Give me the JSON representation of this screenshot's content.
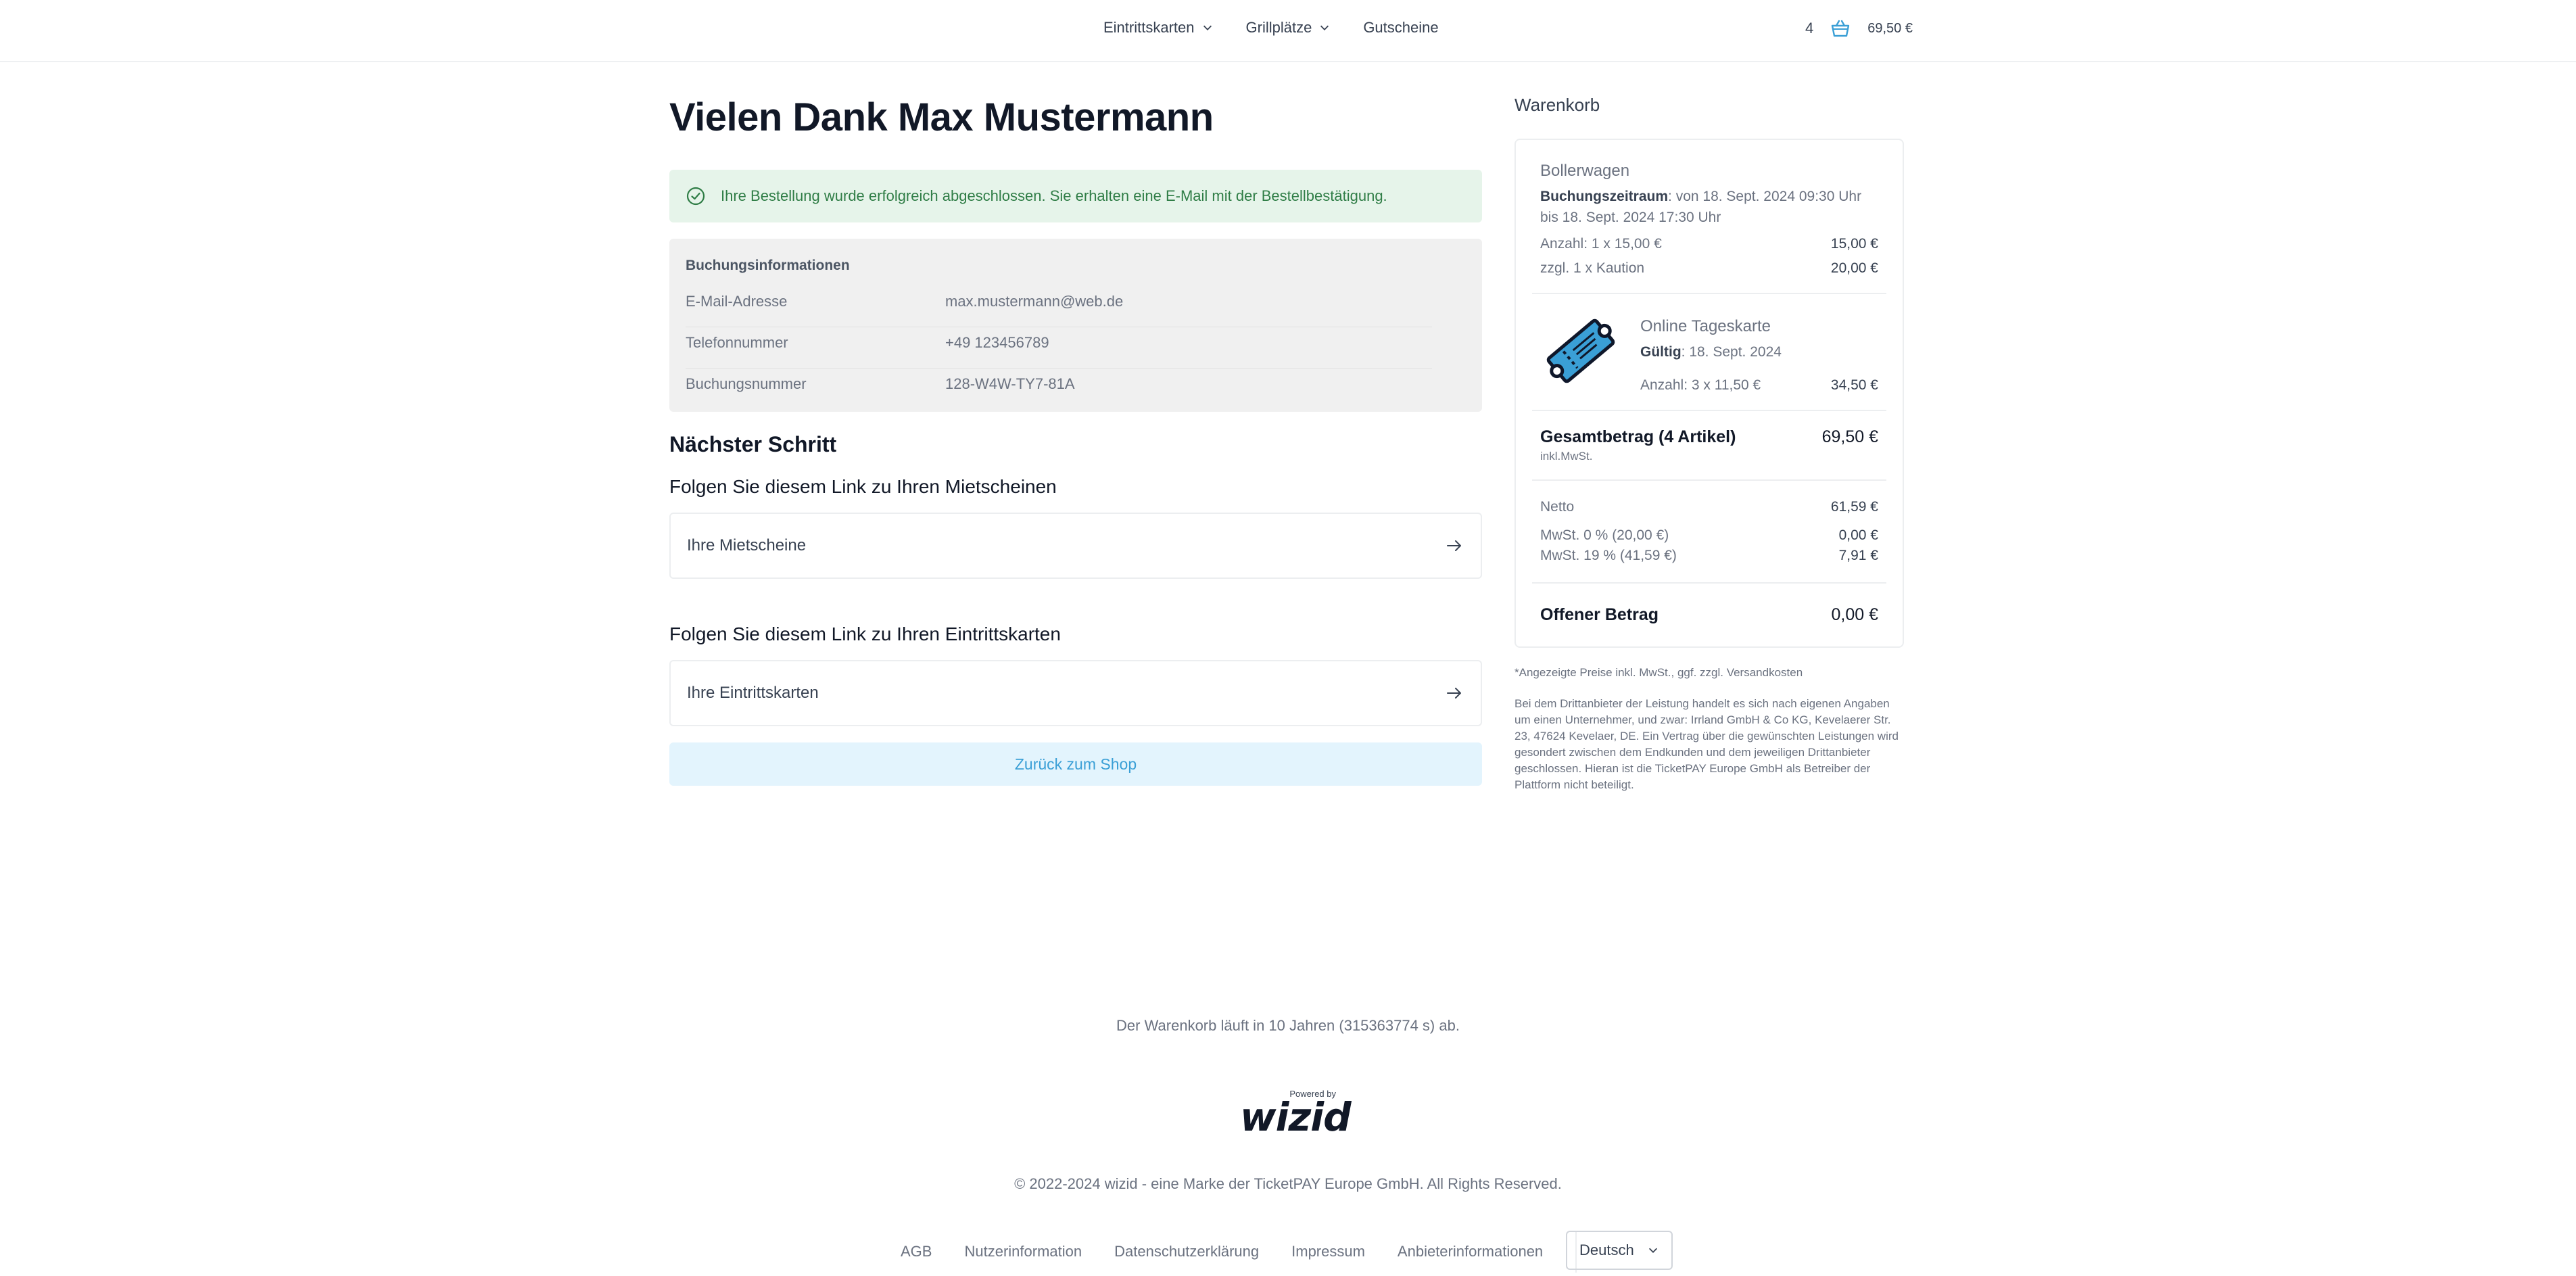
{
  "header": {
    "nav": [
      {
        "label": "Eintrittskarten",
        "has_dropdown": true
      },
      {
        "label": "Grillplätze",
        "has_dropdown": true
      },
      {
        "label": "Gutscheine",
        "has_dropdown": false
      }
    ],
    "cart_count": "4",
    "cart_total": "69,50 €",
    "cart_icon": "basket-icon"
  },
  "main": {
    "title": "Vielen Dank Max Mustermann",
    "success_message": "Ihre Bestellung wurde erfolgreich abgeschlossen. Sie erhalten eine E-Mail mit der Bestellbestätigung.",
    "booking": {
      "title": "Buchungsinformationen",
      "rows": [
        {
          "label": "E-Mail-Adresse",
          "value": "max.mustermann@web.de"
        },
        {
          "label": "Telefonnummer",
          "value": "+49 123456789"
        },
        {
          "label": "Buchungsnummer",
          "value": "128-W4W-TY7-81A"
        }
      ]
    },
    "next_step_title": "Nächster Schritt",
    "links": [
      {
        "heading": "Folgen Sie diesem Link zu Ihren Mietscheinen",
        "label": "Ihre Mietscheine"
      },
      {
        "heading": "Folgen Sie diesem Link zu Ihren Eintrittskarten",
        "label": "Ihre Eintrittskarten"
      }
    ],
    "back_button": "Zurück zum Shop"
  },
  "cart": {
    "title": "Warenkorb",
    "item1": {
      "name": "Bollerwagen",
      "period_label": "Buchungszeitraum",
      "period_value": ": von 18. Sept. 2024 09:30 Uhr bis 18. Sept. 2024 17:30 Uhr",
      "qty_label": "Anzahl: 1 x 15,00 €",
      "qty_value": "15,00 €",
      "deposit_label": "zzgl. 1 x Kaution",
      "deposit_value": "20,00 €"
    },
    "item2": {
      "name": "Online Tageskarte",
      "valid_label": "Gültig",
      "valid_value": ": 18. Sept. 2024",
      "qty_label": "Anzahl: 3 x 11,50 €",
      "qty_value": "34,50 €",
      "icon": "ticket-icon"
    },
    "total_label": "Gesamtbetrag (4 Artikel)",
    "total_value": "69,50 €",
    "incl": "inkl.MwSt.",
    "netto_label": "Netto",
    "netto_value": "61,59 €",
    "tax0_label": "MwSt. 0 % (20,00 €)",
    "tax0_value": "0,00 €",
    "tax19_label": "MwSt. 19 % (41,59 €)",
    "tax19_value": "7,91 €",
    "open_label": "Offener Betrag",
    "open_value": "0,00 €",
    "note": "*Angezeigte Preise inkl. MwSt., ggf. zzgl. Versandkosten",
    "legal": "Bei dem Drittanbieter der Leistung handelt es sich nach eigenen Angaben um einen Unternehmer, und zwar: Irrland GmbH & Co KG, Kevelaerer Str. 23, 47624 Kevelaer, DE. Ein Vertrag über die gewünschten Leistungen wird gesondert zwischen dem Endkunden und dem jeweiligen Drittanbieter geschlossen. Hieran ist die TicketPAY Europe GmbH als Betreiber der Plattform nicht beteiligt."
  },
  "footer": {
    "timer": "Der Warenkorb läuft in 10 Jahren (315363774 s) ab.",
    "powered_by": "Powered by",
    "logo": "wizid",
    "copyright": "© 2022-2024 wizid - eine Marke der TicketPAY Europe GmbH. All Rights Reserved.",
    "links": [
      "AGB",
      "Nutzerinformation",
      "Datenschutzerklärung",
      "Impressum",
      "Anbieterinformationen"
    ],
    "language": "Deutsch"
  }
}
